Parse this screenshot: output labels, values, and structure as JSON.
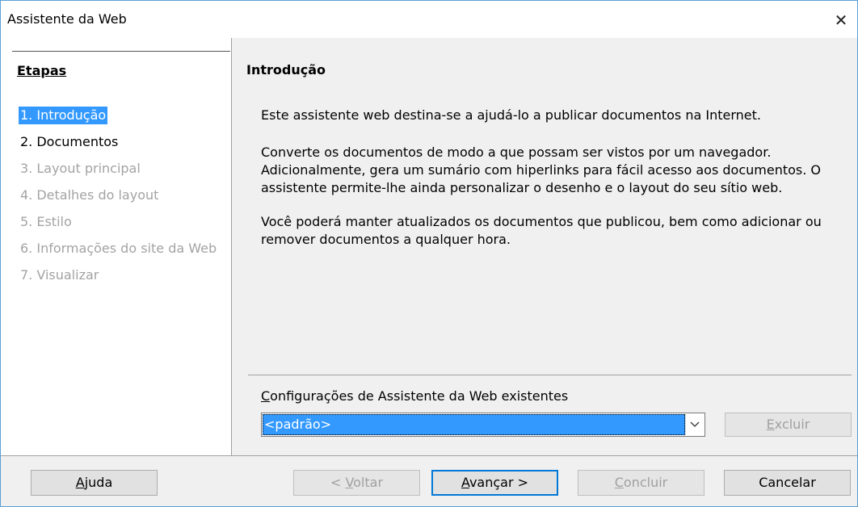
{
  "window": {
    "title": "Assistente da Web",
    "close_glyph": "✕"
  },
  "sidebar": {
    "heading": "Etapas",
    "steps": [
      {
        "label": "1. Introdução",
        "state": "active"
      },
      {
        "label": "2. Documentos",
        "state": "enabled"
      },
      {
        "label": "3. Layout principal",
        "state": "disabled"
      },
      {
        "label": "4. Detalhes do layout",
        "state": "disabled"
      },
      {
        "label": "5. Estilo",
        "state": "disabled"
      },
      {
        "label": "6. Informações do site da Web",
        "state": "disabled"
      },
      {
        "label": "7. Visualizar",
        "state": "disabled"
      }
    ]
  },
  "main": {
    "heading": "Introdução",
    "paragraphs": [
      "Este assistente web destina-se a ajudá-lo a publicar documentos na Internet.",
      "Converte os documentos de modo a que possam ser vistos por um navegador. Adicionalmente, gera um sumário com hiperlinks para fácil acesso aos documentos. O assistente permite-lhe ainda personalizar o desenho e o layout do seu sítio web.",
      "Você poderá manter atualizados os documentos que publicou, bem como adicionar ou remover documentos a qualquer hora."
    ],
    "config": {
      "label_accel": "C",
      "label_rest": "onfigurações de Assistente da Web existentes",
      "selected": "<padrão>",
      "delete_accel": "E",
      "delete_rest": "xcluir"
    }
  },
  "footer": {
    "help_accel": "A",
    "help_rest": "juda",
    "back_prefix": "< ",
    "back_accel": "V",
    "back_rest": "oltar",
    "next_accel": "A",
    "next_rest": "vançar >",
    "finish_accel": "C",
    "finish_rest": "oncluir",
    "cancel": "Cancelar"
  },
  "colors": {
    "selection": "#3399ff",
    "default_button_border": "#0078d7",
    "window_border": "#5aa0d8"
  },
  "icons": {
    "close": "close-icon",
    "dropdown": "chevron-down-icon"
  }
}
